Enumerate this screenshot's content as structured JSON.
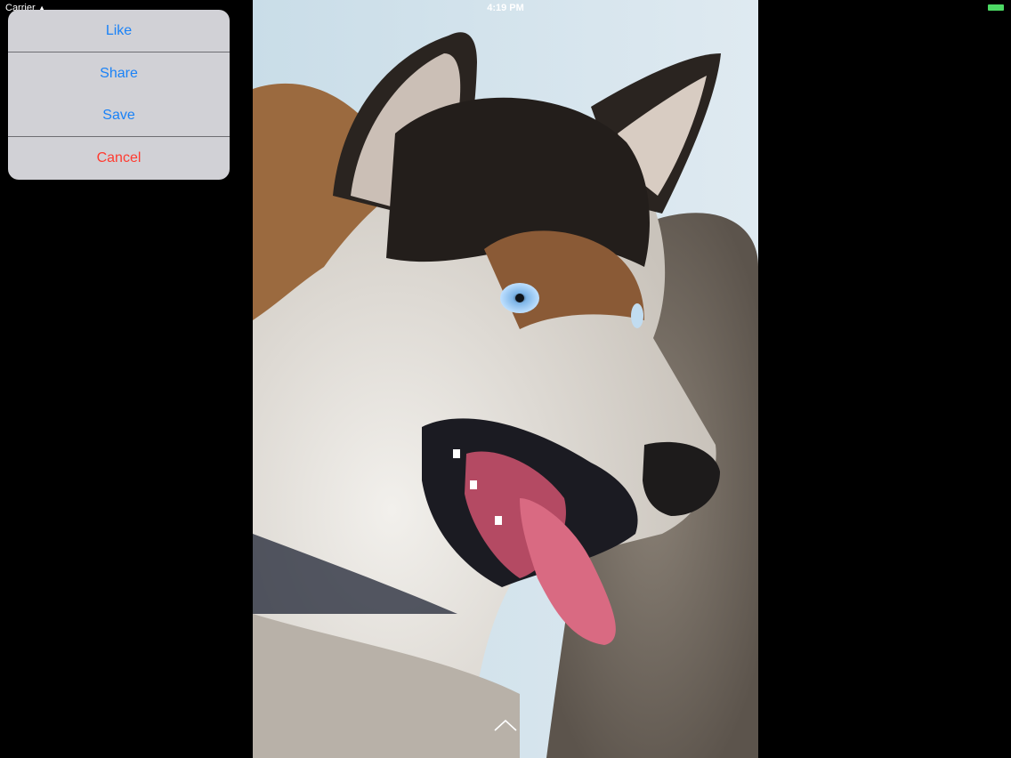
{
  "status_bar": {
    "carrier": "Carrier",
    "time": "4:19 PM",
    "battery_color": "#4cd964"
  },
  "action_sheet": {
    "items": [
      {
        "label": "Like"
      },
      {
        "label": "Share"
      },
      {
        "label": "Save"
      }
    ],
    "cancel_label": "Cancel",
    "tint_color": "#1a82f7",
    "destructive_color": "#ff3b30"
  },
  "icons": {
    "wifi": "wifi-icon",
    "battery": "battery-icon",
    "expand": "chevron-up-icon"
  },
  "photo": {
    "subject": "husky-dog-photo"
  }
}
